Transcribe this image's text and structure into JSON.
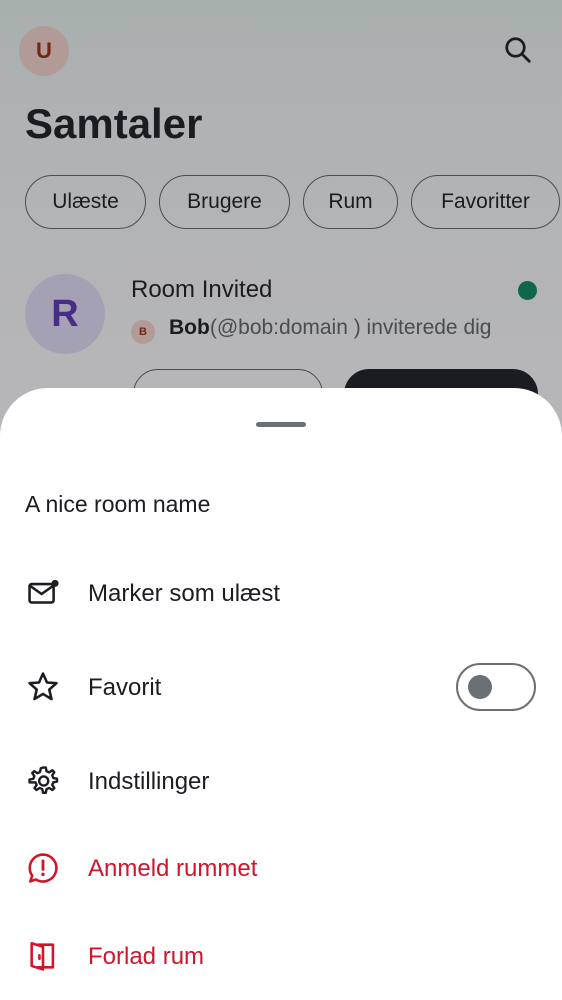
{
  "background": {
    "user_avatar_letter": "U",
    "title": "Samtaler",
    "filters": [
      "Ulæste",
      "Brugere",
      "Rum",
      "Favoritter"
    ],
    "room": {
      "avatar_letter": "R",
      "name": "Room Invited",
      "inviter_avatar_letter": "B",
      "inviter_name": "Bob",
      "invite_text": "(@bob:domain ) inviterede dig"
    }
  },
  "sheet": {
    "title": "A nice room name",
    "items": [
      {
        "label": "Marker som ulæst",
        "icon": "mark-unread-icon"
      },
      {
        "label": "Favorit",
        "icon": "star-icon",
        "toggle": false
      },
      {
        "label": "Indstillinger",
        "icon": "settings-icon"
      },
      {
        "label": "Anmeld rummet",
        "icon": "report-icon",
        "danger": true
      },
      {
        "label": "Forlad rum",
        "icon": "leave-icon",
        "danger": true
      }
    ]
  },
  "colors": {
    "danger": "#d0152b",
    "online": "#0b8a62",
    "room_avatar_bg": "#e6e1fb",
    "user_avatar_bg": "#f9d8cf"
  }
}
